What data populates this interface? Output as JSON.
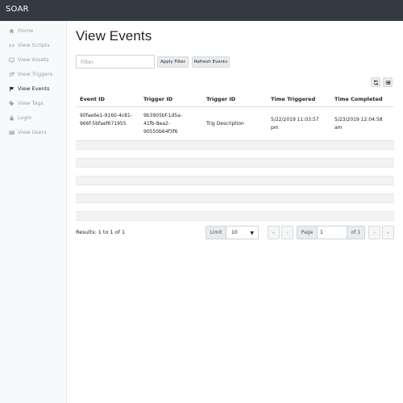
{
  "app": {
    "brand": "SOAR"
  },
  "sidebar": {
    "items": [
      {
        "label": "Home",
        "icon": "home-icon",
        "active": false
      },
      {
        "label": "View Scripts",
        "icon": "code-icon",
        "active": false
      },
      {
        "label": "View Assets",
        "icon": "monitor-icon",
        "active": false
      },
      {
        "label": "View Triggers",
        "icon": "cogs-icon",
        "active": false
      },
      {
        "label": "View Events",
        "icon": "flag-icon",
        "active": true
      },
      {
        "label": "View Tags",
        "icon": "tags-icon",
        "active": false
      },
      {
        "label": "Login",
        "icon": "lock-icon",
        "active": false
      },
      {
        "label": "View Users",
        "icon": "id-card-icon",
        "active": false
      }
    ]
  },
  "page": {
    "title": "View Events"
  },
  "toolbar": {
    "filter_placeholder": "Filter",
    "apply_label": "Apply Filter",
    "refresh_label": "Refresh Events"
  },
  "table": {
    "columns": [
      "Event ID",
      "Trigger ID",
      "Trigger ID",
      "Time Triggered",
      "Time Completed"
    ],
    "rows": [
      {
        "event_id_lines": [
          "90fae6e1-9160-4c81-",
          "966f-5bfaef671955"
        ],
        "trigger_id_lines": [
          "9b3905bf-1d5a-",
          "41fb-8ea2-",
          "90550b64f3f6"
        ],
        "trigger_desc": "Trig Description",
        "time_triggered_lines": [
          "5/22/2019 11:03:57",
          "pm"
        ],
        "time_completed_lines": [
          "5/23/2019 12:04:58",
          "am"
        ]
      }
    ],
    "empty_row_count": 9
  },
  "footer": {
    "results": "Results: 1 to 1 of 1",
    "limit_label": "Limit",
    "limit_value": "10",
    "page_label": "Page",
    "page_value": "1",
    "page_of": "of 1"
  },
  "colors": {
    "topbar": "#343a40",
    "sidebar_bg": "#f8f9fa",
    "stripe": "#f2f2f2"
  }
}
